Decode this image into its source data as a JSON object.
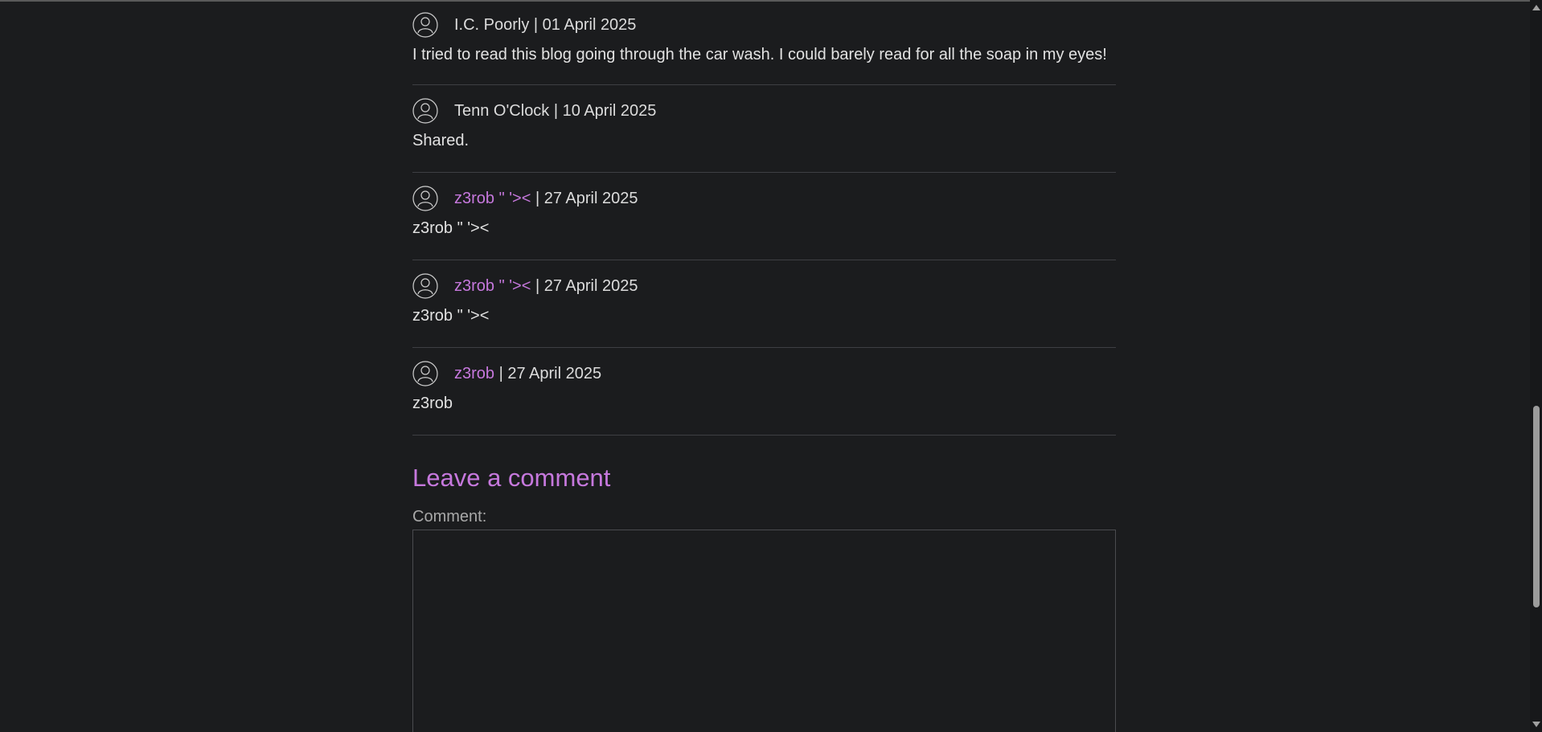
{
  "comments": [
    {
      "author": "I.C. Poorly",
      "author_is_link": false,
      "date": "01 April 2025",
      "text": "I tried to read this blog going through the car wash. I could barely read for all the soap in my eyes!"
    },
    {
      "author": "Tenn O'Clock",
      "author_is_link": false,
      "date": "10 April 2025",
      "text": "Shared."
    },
    {
      "author": "z3rob \" '><",
      "author_is_link": true,
      "date": "27 April 2025",
      "text": "z3rob \" '><"
    },
    {
      "author": "z3rob \" '><",
      "author_is_link": true,
      "date": "27 April 2025",
      "text": "z3rob \" '><"
    },
    {
      "author": "z3rob",
      "author_is_link": true,
      "date": "27 April 2025",
      "text": "z3rob"
    }
  ],
  "separator": " | ",
  "leave_comment": {
    "title": "Leave a comment",
    "comment_label": "Comment:",
    "comment_value": ""
  },
  "icons": {
    "avatar": "user-avatar-icon"
  },
  "colors": {
    "background": "#1b1c1e",
    "text": "#dcdcdc",
    "accent_link": "#c678dd",
    "divider": "#3e3f43"
  }
}
